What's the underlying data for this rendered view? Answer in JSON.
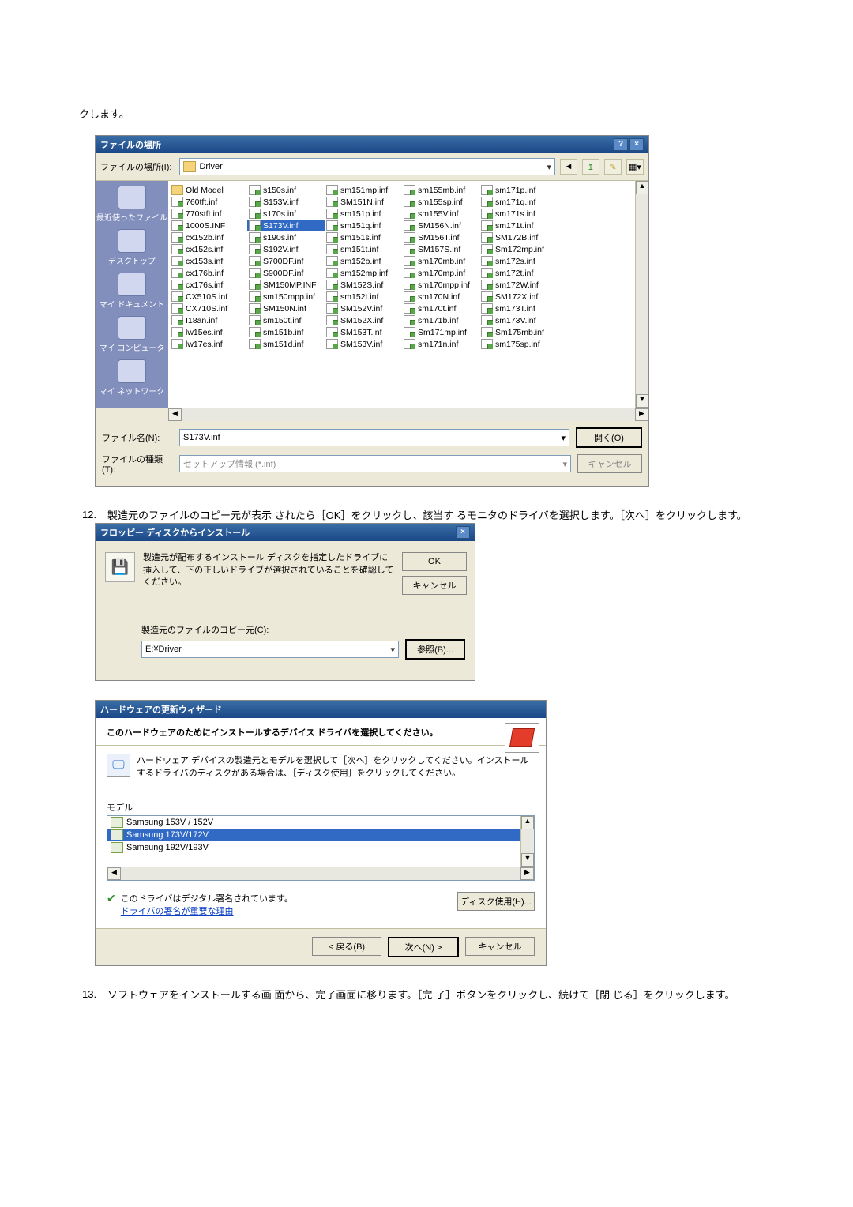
{
  "intro_text": "クします。",
  "file_dialog": {
    "title": "ファイルの場所",
    "lookin_label": "ファイルの場所(I):",
    "folder": "Driver",
    "toolbar_icons": [
      "back-icon",
      "up-icon",
      "folder-icon",
      "views-icon"
    ],
    "places": [
      "最近使ったファイル",
      "デスクトップ",
      "マイ ドキュメント",
      "マイ コンピュータ",
      "マイ ネットワーク"
    ],
    "columns": [
      [
        {
          "name": "Old Model",
          "type": "folder"
        },
        {
          "name": "760tft.inf",
          "type": "inf"
        },
        {
          "name": "770stft.inf",
          "type": "inf"
        },
        {
          "name": "1000S.INF",
          "type": "inf"
        },
        {
          "name": "cx152b.inf",
          "type": "inf"
        },
        {
          "name": "cx152s.inf",
          "type": "inf"
        },
        {
          "name": "cx153s.inf",
          "type": "inf"
        },
        {
          "name": "cx176b.inf",
          "type": "inf"
        },
        {
          "name": "cx176s.inf",
          "type": "inf"
        },
        {
          "name": "CX510S.inf",
          "type": "inf"
        },
        {
          "name": "CX710S.inf",
          "type": "inf"
        },
        {
          "name": "I18an.inf",
          "type": "inf"
        },
        {
          "name": "lw15es.inf",
          "type": "inf"
        },
        {
          "name": "lw17es.inf",
          "type": "inf"
        }
      ],
      [
        {
          "name": "s150s.inf",
          "type": "inf"
        },
        {
          "name": "S153V.inf",
          "type": "inf"
        },
        {
          "name": "s170s.inf",
          "type": "inf"
        },
        {
          "name": "S173V.inf",
          "type": "inf",
          "selected": true
        },
        {
          "name": "s190s.inf",
          "type": "inf"
        },
        {
          "name": "S192V.inf",
          "type": "inf"
        },
        {
          "name": "S700DF.inf",
          "type": "inf"
        },
        {
          "name": "S900DF.inf",
          "type": "inf"
        },
        {
          "name": "SM150MP.INF",
          "type": "inf"
        },
        {
          "name": "sm150mpp.inf",
          "type": "inf"
        },
        {
          "name": "SM150N.inf",
          "type": "inf"
        },
        {
          "name": "sm150t.inf",
          "type": "inf"
        },
        {
          "name": "sm151b.inf",
          "type": "inf"
        },
        {
          "name": "sm151d.inf",
          "type": "inf"
        }
      ],
      [
        {
          "name": "sm151mp.inf",
          "type": "inf"
        },
        {
          "name": "SM151N.inf",
          "type": "inf"
        },
        {
          "name": "sm151p.inf",
          "type": "inf"
        },
        {
          "name": "sm151q.inf",
          "type": "inf"
        },
        {
          "name": "sm151s.inf",
          "type": "inf"
        },
        {
          "name": "sm151t.inf",
          "type": "inf"
        },
        {
          "name": "sm152b.inf",
          "type": "inf"
        },
        {
          "name": "sm152mp.inf",
          "type": "inf"
        },
        {
          "name": "SM152S.inf",
          "type": "inf"
        },
        {
          "name": "sm152t.inf",
          "type": "inf"
        },
        {
          "name": "SM152V.inf",
          "type": "inf"
        },
        {
          "name": "SM152X.inf",
          "type": "inf"
        },
        {
          "name": "SM153T.inf",
          "type": "inf"
        },
        {
          "name": "SM153V.inf",
          "type": "inf"
        }
      ],
      [
        {
          "name": "sm155mb.inf",
          "type": "inf"
        },
        {
          "name": "sm155sp.inf",
          "type": "inf"
        },
        {
          "name": "sm155V.inf",
          "type": "inf"
        },
        {
          "name": "SM156N.inf",
          "type": "inf"
        },
        {
          "name": "SM156T.inf",
          "type": "inf"
        },
        {
          "name": "SM157S.inf",
          "type": "inf"
        },
        {
          "name": "sm170mb.inf",
          "type": "inf"
        },
        {
          "name": "sm170mp.inf",
          "type": "inf"
        },
        {
          "name": "sm170mpp.inf",
          "type": "inf"
        },
        {
          "name": "sm170N.inf",
          "type": "inf"
        },
        {
          "name": "sm170t.inf",
          "type": "inf"
        },
        {
          "name": "sm171b.inf",
          "type": "inf"
        },
        {
          "name": "Sm171mp.inf",
          "type": "inf"
        },
        {
          "name": "sm171n.inf",
          "type": "inf"
        }
      ],
      [
        {
          "name": "sm171p.inf",
          "type": "inf"
        },
        {
          "name": "sm171q.inf",
          "type": "inf"
        },
        {
          "name": "sm171s.inf",
          "type": "inf"
        },
        {
          "name": "sm171t.inf",
          "type": "inf"
        },
        {
          "name": "SM172B.inf",
          "type": "inf"
        },
        {
          "name": "Sm172mp.inf",
          "type": "inf"
        },
        {
          "name": "sm172s.inf",
          "type": "inf"
        },
        {
          "name": "sm172t.inf",
          "type": "inf"
        },
        {
          "name": "sm172W.inf",
          "type": "inf"
        },
        {
          "name": "SM172X.inf",
          "type": "inf"
        },
        {
          "name": "sm173T.inf",
          "type": "inf"
        },
        {
          "name": "sm173V.inf",
          "type": "inf"
        },
        {
          "name": "Sm175mb.inf",
          "type": "inf"
        },
        {
          "name": "sm175sp.inf",
          "type": "inf"
        }
      ]
    ],
    "filename_label": "ファイル名(N):",
    "filename_value": "S173V.inf",
    "filetype_label": "ファイルの種類(T):",
    "filetype_value": "セットアップ情報 (*.inf)",
    "open_btn": "開く(O)",
    "cancel_btn": "キャンセル"
  },
  "step12": {
    "num": "12.",
    "text": "製造元のファイルのコピー元が表示 されたら［OK］をクリックし、該当す るモニタのドライバを選択します。［次へ］をクリックします。"
  },
  "floppy": {
    "title": "フロッピー ディスクからインストール",
    "msg": "製造元が配布するインストール ディスクを指定したドライブに挿入して、下の正しいドライブが選択されていることを確認してください。",
    "ok": "OK",
    "cancel": "キャンセル",
    "src_label": "製造元のファイルのコピー元(C):",
    "src_value": "E:¥Driver",
    "browse": "参照(B)..."
  },
  "hw": {
    "title": "ハードウェアの更新ウィザード",
    "head": "このハードウェアのためにインストールするデバイス ドライバを選択してください。",
    "note": "ハードウェア デバイスの製造元とモデルを選択して［次へ］をクリックしてください。インストールするドライバのディスクがある場合は、［ディスク使用］をクリックしてください。",
    "model_label": "モデル",
    "models": [
      {
        "name": "Samsung 153V / 152V",
        "selected": false
      },
      {
        "name": "Samsung 173V/172V",
        "selected": true
      },
      {
        "name": "Samsung 192V/193V",
        "selected": false
      }
    ],
    "signed": "このドライバはデジタル署名されています。",
    "signed_link": "ドライバの署名が重要な理由",
    "disk_btn": "ディスク使用(H)...",
    "back": "< 戻る(B)",
    "next": "次へ(N) >",
    "cancel": "キャンセル"
  },
  "step13": {
    "num": "13.",
    "text": "ソフトウェアをインストールする画 面から、完了画面に移ります。［完 了］ボタンをクリックし、続けて［閉 じる］をクリックします。"
  }
}
